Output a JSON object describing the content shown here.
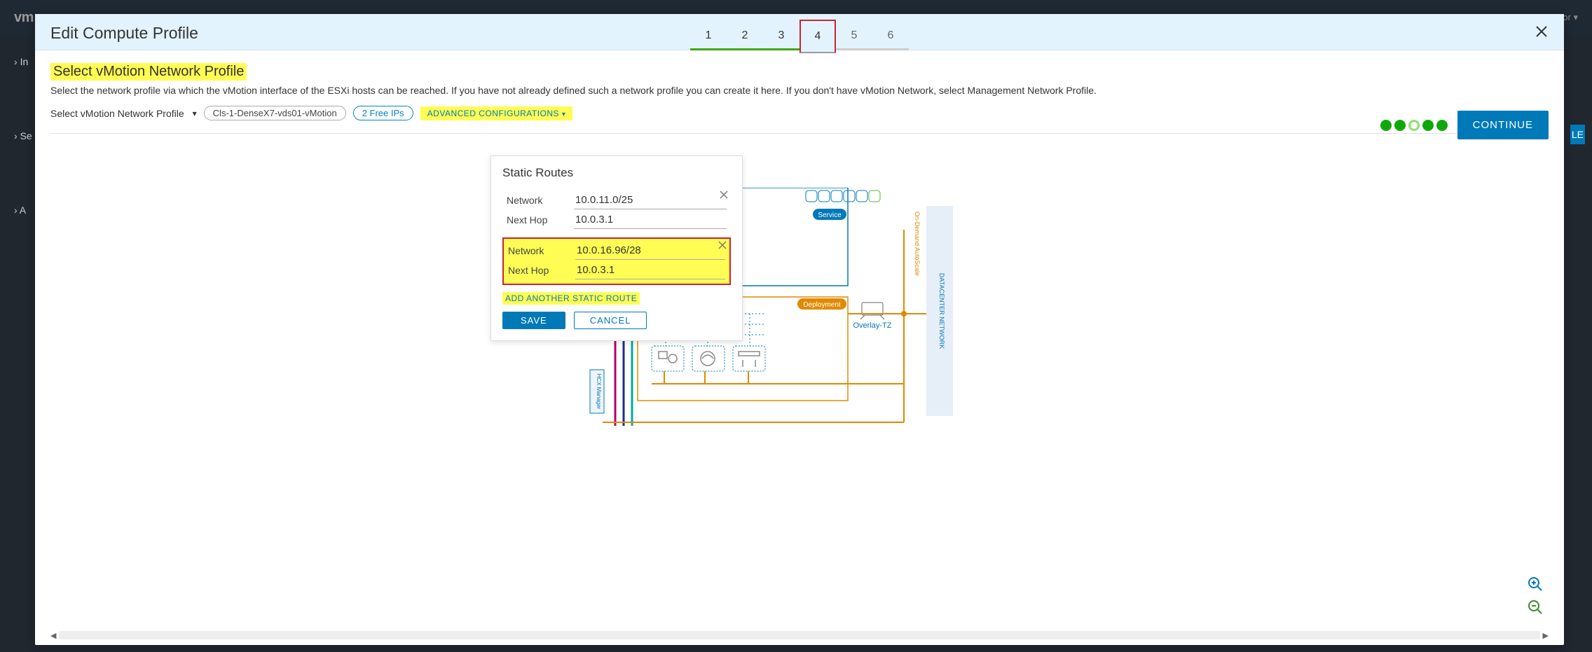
{
  "header": {
    "logo": "vm",
    "user_menu": "or"
  },
  "behind": {
    "in_label": "In",
    "se_label": "Se",
    "a_label": "A",
    "le_btn": "LE"
  },
  "modal": {
    "title": "Edit Compute Profile",
    "steps": [
      "1",
      "2",
      "3",
      "4",
      "5",
      "6"
    ],
    "continue": "CONTINUE"
  },
  "section": {
    "title": "Select vMotion Network Profile",
    "desc": "Select the network profile via which the vMotion interface of the ESXi hosts can be reached. If you have not already defined such a network profile you can create it here. If you don't have vMotion Network, select Management Network Profile.",
    "selector_label": "Select vMotion Network Profile",
    "profile_name": "Cls-1-DenseX7-vds01-vMotion",
    "free_ips": "2 Free IPs",
    "adv_config": "ADVANCED CONFIGURATIONS"
  },
  "popover": {
    "title": "Static Routes",
    "labels": {
      "network": "Network",
      "next_hop": "Next Hop"
    },
    "routes": [
      {
        "network": "10.0.11.0/25",
        "next_hop": "10.0.3.1"
      },
      {
        "network": "10.0.16.96/28",
        "next_hop": "10.0.3.1"
      }
    ],
    "add_route": "ADD ANOTHER STATIC ROUTE",
    "save": "SAVE",
    "cancel": "CANCEL"
  },
  "diagram": {
    "service_badge": "Service",
    "deployment_badge": "Deployment",
    "overlay_label": "Overlay-TZ",
    "right_label": "DATACENTER NETWORK",
    "top_label": "On-Demand AutoScale",
    "hcx_label": "HCX Manager"
  }
}
